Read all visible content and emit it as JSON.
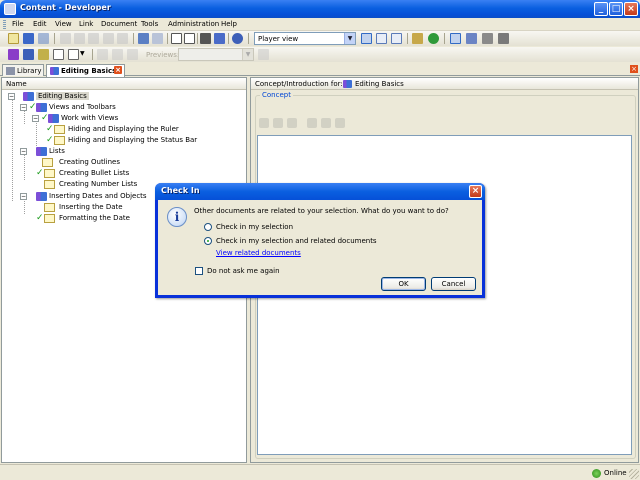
{
  "window": {
    "title": "Content - Developer"
  },
  "menu": [
    "File",
    "Edit",
    "View",
    "Link",
    "Document",
    "Tools",
    "Administration",
    "Help"
  ],
  "toolbar": {
    "view_combo": "Player view",
    "preview_label": "Previews:"
  },
  "tabs": [
    {
      "label": "Library",
      "active": false
    },
    {
      "label": "Editing Basics",
      "active": true
    }
  ],
  "tree": {
    "header": "Name",
    "nodes": [
      {
        "label": "Editing Basics",
        "level": 0,
        "type": "book",
        "selected": true
      },
      {
        "label": "Views and Toolbars",
        "level": 1,
        "type": "book",
        "checked": true
      },
      {
        "label": "Work with Views",
        "level": 2,
        "type": "book",
        "checked": true
      },
      {
        "label": "Hiding and Displaying the Ruler",
        "level": 3,
        "type": "topic",
        "checked": true
      },
      {
        "label": "Hiding and Displaying the Status Bar",
        "level": 3,
        "type": "topic",
        "checked": true
      },
      {
        "label": "Lists",
        "level": 1,
        "type": "book",
        "checked": false
      },
      {
        "label": "Creating Outlines",
        "level": 2,
        "type": "topic",
        "checked": false
      },
      {
        "label": "Creating Bullet Lists",
        "level": 2,
        "type": "topic",
        "checked": true
      },
      {
        "label": "Creating Number Lists",
        "level": 2,
        "type": "topic",
        "checked": false
      },
      {
        "label": "Inserting Dates and Objects",
        "level": 1,
        "type": "book",
        "checked": false
      },
      {
        "label": "Inserting the Date",
        "level": 2,
        "type": "topic",
        "checked": false
      },
      {
        "label": "Formatting the Date",
        "level": 2,
        "type": "topic",
        "checked": true
      }
    ]
  },
  "right": {
    "header_label": "Concept/Introduction for:",
    "header_doc": "Editing Basics",
    "group_label": "Concept"
  },
  "dialog": {
    "title": "Check In",
    "message": "Other documents are related to your selection. What do you want to do?",
    "option1": "Check in my selection",
    "option2": "Check in my selection and related documents",
    "selected_option": 2,
    "link": "View related documents",
    "checkbox_label": "Do not ask me again",
    "checkbox_checked": false,
    "ok": "OK",
    "cancel": "Cancel"
  },
  "status": {
    "text": "Online"
  }
}
